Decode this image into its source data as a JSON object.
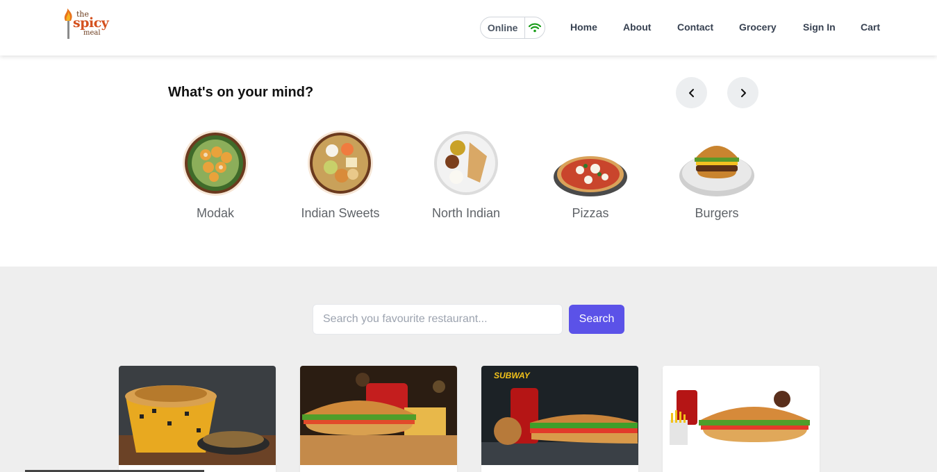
{
  "brand": {
    "line1": "the",
    "line2": "spicy",
    "line3": "meal"
  },
  "status": {
    "label": "Online",
    "icon": "wifi-icon",
    "color": "#1a9c1a"
  },
  "nav": {
    "home": "Home",
    "about": "About",
    "contact": "Contact",
    "grocery": "Grocery",
    "sign_in": "Sign In",
    "cart": "Cart"
  },
  "mind": {
    "title": "What's on your mind?",
    "prev_icon": "chevron-left-icon",
    "next_icon": "chevron-right-icon",
    "categories": [
      {
        "label": "Modak"
      },
      {
        "label": "Indian Sweets"
      },
      {
        "label": "North Indian"
      },
      {
        "label": "Pizzas"
      },
      {
        "label": "Burgers"
      }
    ]
  },
  "search": {
    "placeholder": "Search you favourite restaurant...",
    "value": "",
    "button": "Search"
  },
  "accent": "#5b52e8"
}
